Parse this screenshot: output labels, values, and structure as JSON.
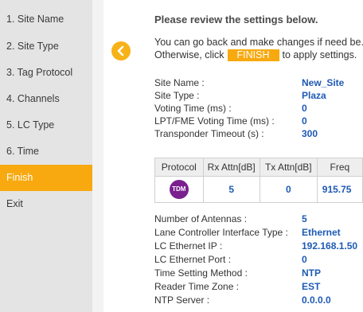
{
  "sidebar": {
    "items": [
      {
        "label": "1. Site Name"
      },
      {
        "label": "2. Site Type"
      },
      {
        "label": "3. Tag Protocol"
      },
      {
        "label": "4. Channels"
      },
      {
        "label": "5. LC Type"
      },
      {
        "label": "6. Time"
      },
      {
        "label": "Finish"
      },
      {
        "label": "Exit"
      }
    ],
    "active_index": 6
  },
  "main": {
    "heading": "Please review the settings below.",
    "intro_line1": "You can go back and make changes if need be.",
    "intro_line2_pre": "Otherwise, click",
    "finish_label": "FINISH",
    "intro_line2_post": "to apply settings.",
    "settings_top": [
      {
        "label": "Site Name :",
        "value": "New_Site"
      },
      {
        "label": "Site Type :",
        "value": "Plaza"
      },
      {
        "label": "Voting Time (ms) :",
        "value": "0"
      },
      {
        "label": "LPT/FME Voting Time (ms) :",
        "value": "0"
      },
      {
        "label": "Transponder Timeout (s) :",
        "value": "300"
      }
    ],
    "protocol_table": {
      "headers": [
        "Protocol",
        "Rx Attn[dB]",
        "Tx Attn[dB]",
        "Freq"
      ],
      "row": {
        "protocol": "TDM",
        "rx": "5",
        "tx": "0",
        "freq": "915.75"
      }
    },
    "settings_bottom": [
      {
        "label": "Number of Antennas :",
        "value": "5"
      },
      {
        "label": "Lane Controller Interface Type :",
        "value": "Ethernet"
      },
      {
        "label": "LC Ethernet IP :",
        "value": "192.168.1.50"
      },
      {
        "label": "LC Ethernet Port :",
        "value": "0"
      },
      {
        "label": "Time Setting Method :",
        "value": "NTP"
      },
      {
        "label": "Reader Time Zone :",
        "value": "EST"
      },
      {
        "label": "NTP Server :",
        "value": "0.0.0.0"
      }
    ]
  },
  "colors": {
    "accent": "#f7a90f",
    "value_blue": "#1e5ab4",
    "tdm_badge": "#7b1f8f",
    "sidebar_bg": "#e4e4e4"
  },
  "icons": {
    "back": "chevron-left-icon"
  }
}
